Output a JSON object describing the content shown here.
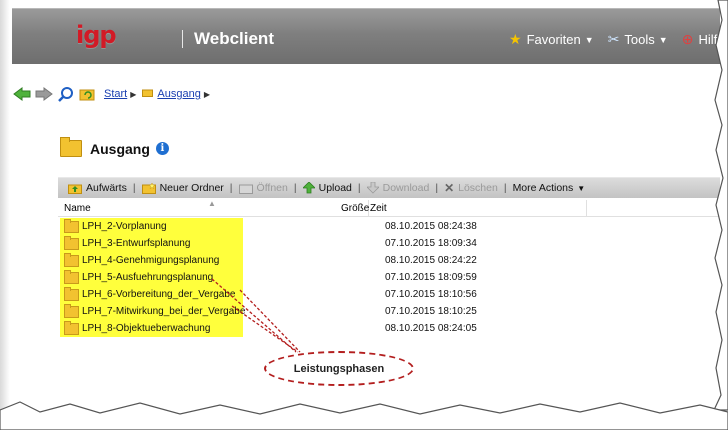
{
  "header": {
    "logo": "igp",
    "app_title": "Webclient",
    "nav": [
      {
        "label": "Favoriten",
        "icon": "star-icon"
      },
      {
        "label": "Tools",
        "icon": "tools-icon"
      },
      {
        "label": "Hilfe",
        "icon": "help-icon"
      }
    ]
  },
  "breadcrumb": {
    "items": [
      "Start",
      "Ausgang"
    ]
  },
  "folder": {
    "title": "Ausgang"
  },
  "toolbar": {
    "up": "Aufwärts",
    "new_folder": "Neuer Ordner",
    "open": "Öffnen",
    "upload": "Upload",
    "download": "Download",
    "delete": "Löschen",
    "more": "More Actions"
  },
  "columns": {
    "name": "Name",
    "size": "Größe",
    "time": "Zeit"
  },
  "rows": [
    {
      "name": "LPH_2-Vorplanung",
      "time": "08.10.2015 08:24:38"
    },
    {
      "name": "LPH_3-Entwurfsplanung",
      "time": "07.10.2015 18:09:34"
    },
    {
      "name": "LPH_4-Genehmigungsplanung",
      "time": "08.10.2015 08:24:22"
    },
    {
      "name": "LPH_5-Ausfuehrungsplanung",
      "time": "07.10.2015 18:09:59"
    },
    {
      "name": "LPH_6-Vorbereitung_der_Vergabe",
      "time": "07.10.2015 18:10:56"
    },
    {
      "name": "LPH_7-Mitwirkung_bei_der_Vergabe",
      "time": "07.10.2015 18:10:25"
    },
    {
      "name": "LPH_8-Objektueberwachung",
      "time": "08.10.2015 08:24:05"
    }
  ],
  "callout": {
    "label": "Leistungsphasen"
  },
  "colors": {
    "highlight": "#ffff3c",
    "callout_border": "#b31e1e",
    "brand": "#d21a26"
  }
}
